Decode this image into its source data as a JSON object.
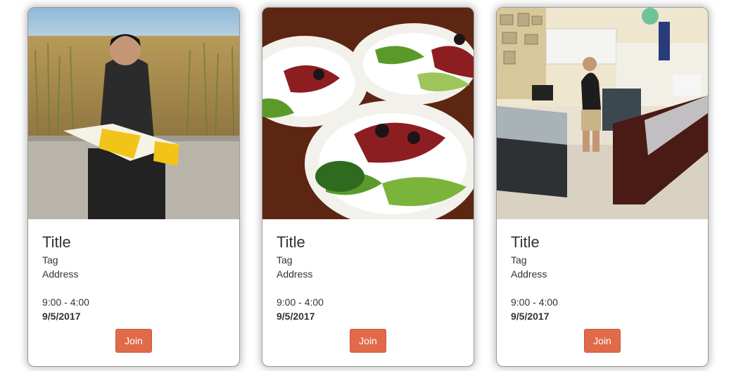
{
  "cards": [
    {
      "image": "person-reading-map-outdoors",
      "title": "Title",
      "tag": "Tag",
      "address": "Address",
      "time": "9:00 - 4:00",
      "date": "9/5/2017",
      "button": "Join"
    },
    {
      "image": "plated-food-dishes",
      "title": "Title",
      "tag": "Tag",
      "address": "Address",
      "time": "9:00 - 4:00",
      "date": "9/5/2017",
      "button": "Join"
    },
    {
      "image": "store-interior-with-display-cases",
      "title": "Title",
      "tag": "Tag",
      "address": "Address",
      "time": "9:00 - 4:00",
      "date": "9/5/2017",
      "button": "Join"
    }
  ],
  "colors": {
    "button_bg": "#e06a4a",
    "button_text": "#ffffff",
    "card_border": "#9a9a9a"
  }
}
